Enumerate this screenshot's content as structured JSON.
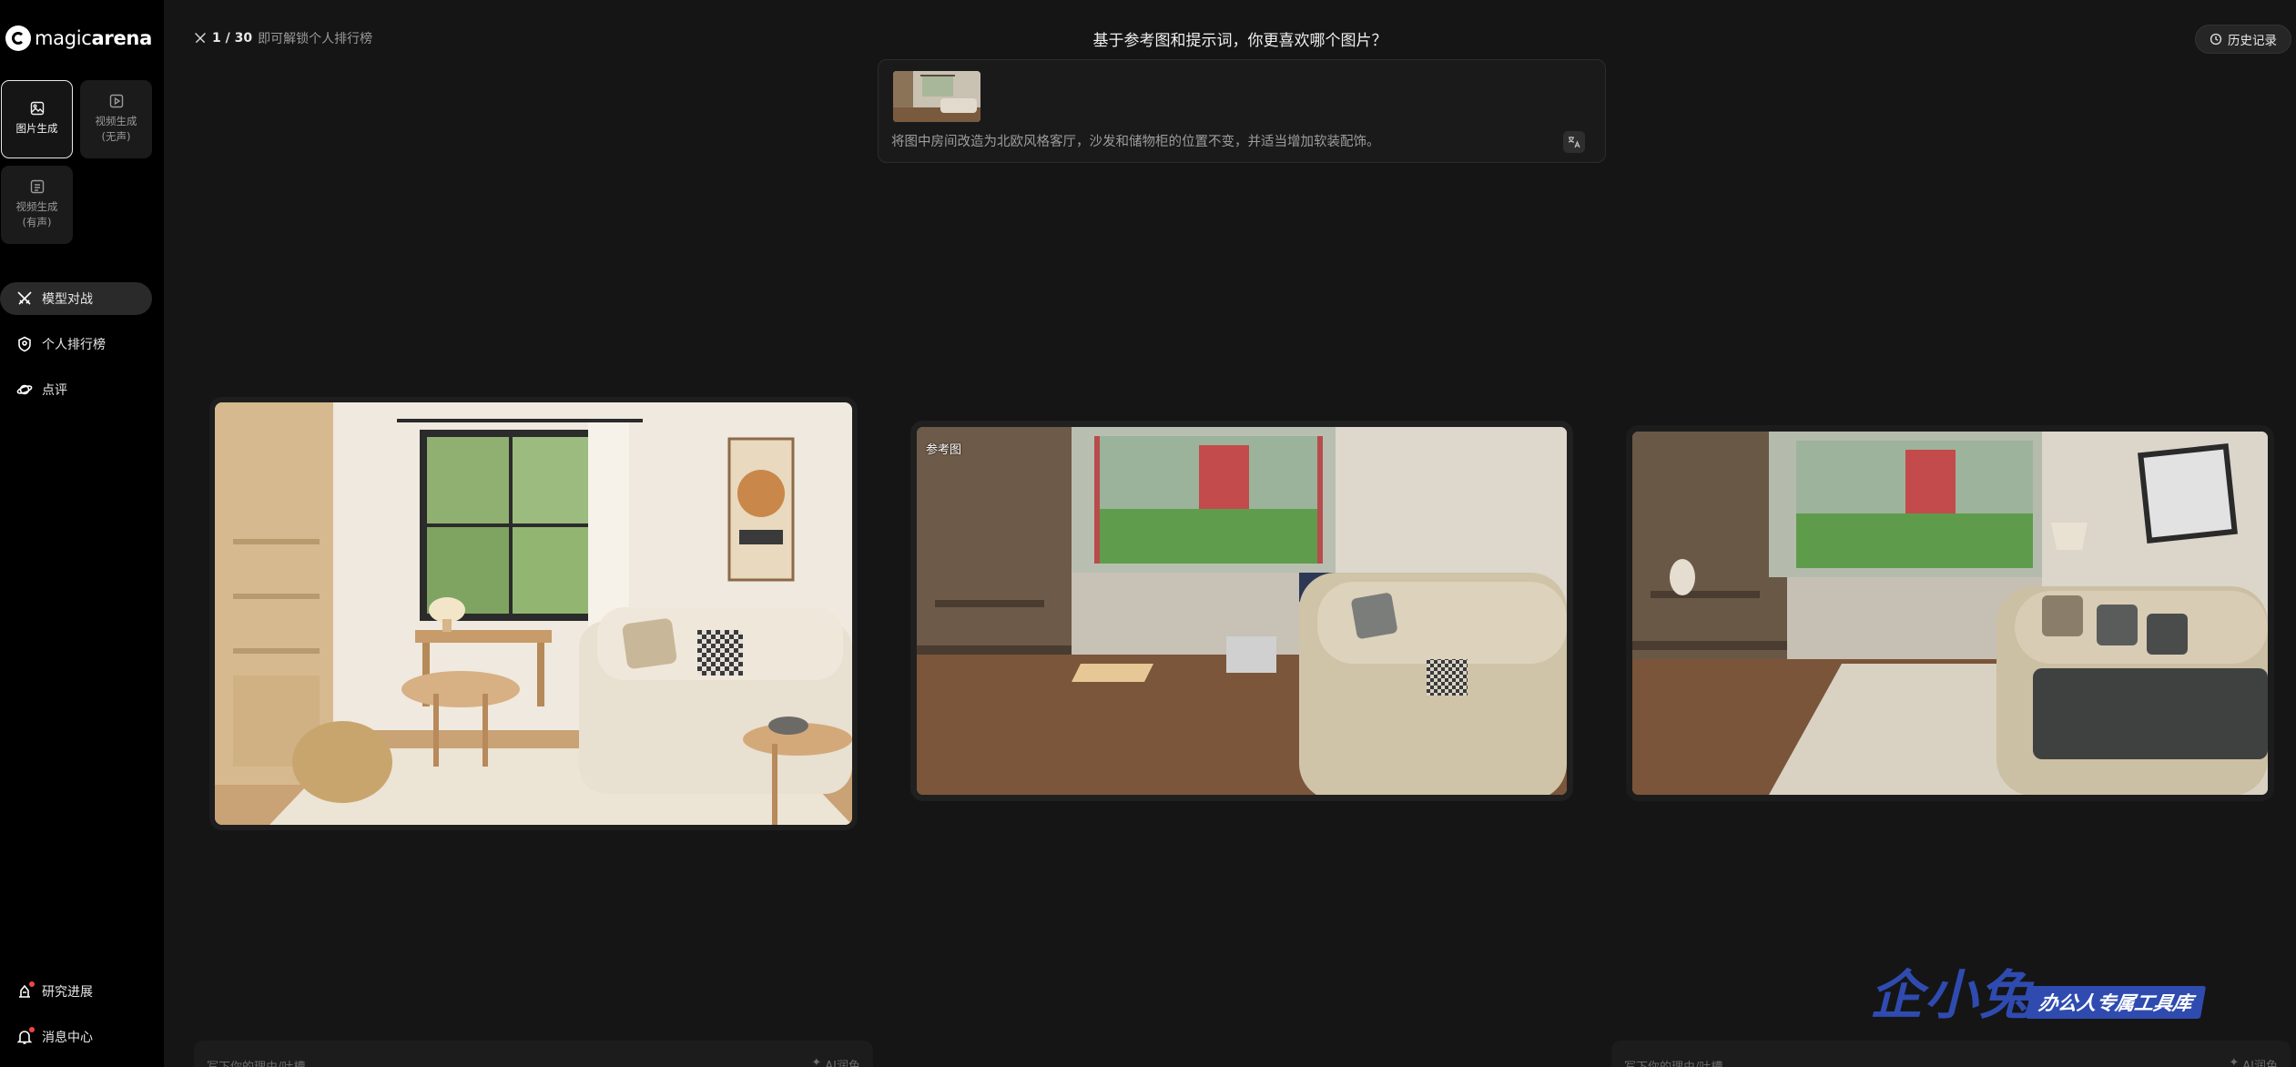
{
  "app": {
    "logo_regular": "magic",
    "logo_bold": "arena"
  },
  "modes": [
    {
      "label": "图片生成",
      "active": true
    },
    {
      "label": "视频生成\n(无声)",
      "active": false
    },
    {
      "label": "视频生成\n(有声)",
      "active": false
    }
  ],
  "nav": {
    "battle": "模型对战",
    "personal_rank": "个人排行榜",
    "review": "点评",
    "research": "研究进展",
    "messages": "消息中心"
  },
  "topbar": {
    "progress_count": "1 / 30",
    "progress_hint": "即可解锁个人排行榜",
    "question": "基于参考图和提示词，你更喜欢哪个图片？",
    "history": "历史记录"
  },
  "prompt": {
    "text": "将图中房间改造为北欧风格客厅，沙发和储物柜的位置不变，并适当增加软装配饰。"
  },
  "reference": {
    "tag": "参考图"
  },
  "bottom": {
    "placeholder": "写下你的理由/吐槽",
    "polish": "AI润色"
  },
  "watermark": {
    "main": "企小兔",
    "sub": "办公人专属工具库"
  },
  "colors": {
    "background": "#151515",
    "sidebar": "#000000",
    "watermark": "#2f4bb0"
  }
}
